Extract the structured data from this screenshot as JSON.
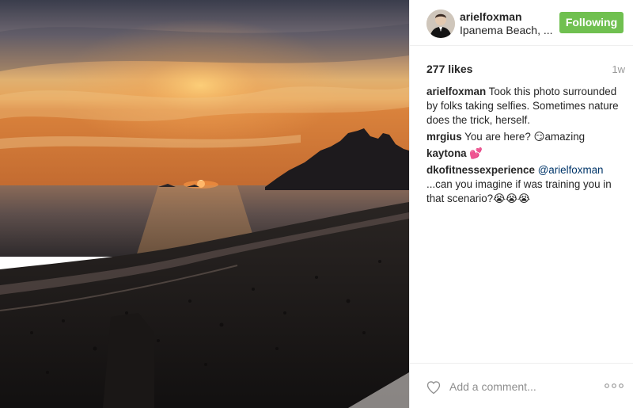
{
  "post": {
    "author": "arielfoxman",
    "location": "Ipanema Beach, ...",
    "follow_label": "Following",
    "likes": "277 likes",
    "age": "1w"
  },
  "comments": [
    {
      "author": "arielfoxman",
      "text": " Took this photo surrounded by folks taking selfies. Sometimes nature does the trick, herself."
    },
    {
      "author": "mrgius",
      "text": " You are here? ",
      "emoji": "😏",
      "text2": "amazing"
    },
    {
      "author": "kaytona",
      "text": " ",
      "emoji": "💕"
    },
    {
      "author": "dkofitnessexperience",
      "mention": "@arielfoxman",
      "text": " ...can you imagine if was training you in that scenario?",
      "emoji": "😭😭😭"
    }
  ],
  "footer": {
    "comment_placeholder": "Add a comment...",
    "like_icon": "heart-outline-icon",
    "more_icon": "ellipsis-icon"
  },
  "colors": {
    "follow_button": "#70c050",
    "mention": "#003569",
    "muted": "#999999"
  }
}
